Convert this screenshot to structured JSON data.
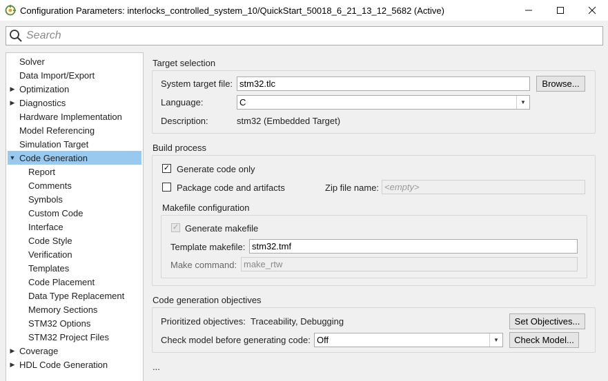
{
  "window": {
    "title": "Configuration Parameters: interlocks_controlled_system_10/QuickStart_50018_6_21_13_12_5682 (Active)",
    "controls": {
      "minimize": "—",
      "maximize": "☐",
      "close": "✕"
    }
  },
  "search": {
    "placeholder": "Search",
    "value": ""
  },
  "sidebar": {
    "items": [
      {
        "label": "Solver",
        "expandable": false,
        "selected": false
      },
      {
        "label": "Data Import/Export",
        "expandable": false,
        "selected": false
      },
      {
        "label": "Optimization",
        "expandable": true,
        "expanded": false,
        "selected": false
      },
      {
        "label": "Diagnostics",
        "expandable": true,
        "expanded": false,
        "selected": false
      },
      {
        "label": "Hardware Implementation",
        "expandable": false,
        "selected": false
      },
      {
        "label": "Model Referencing",
        "expandable": false,
        "selected": false
      },
      {
        "label": "Simulation Target",
        "expandable": false,
        "selected": false
      },
      {
        "label": "Code Generation",
        "expandable": true,
        "expanded": true,
        "selected": true
      },
      {
        "label": "Report",
        "child": true
      },
      {
        "label": "Comments",
        "child": true
      },
      {
        "label": "Symbols",
        "child": true
      },
      {
        "label": "Custom Code",
        "child": true
      },
      {
        "label": "Interface",
        "child": true
      },
      {
        "label": "Code Style",
        "child": true
      },
      {
        "label": "Verification",
        "child": true
      },
      {
        "label": "Templates",
        "child": true
      },
      {
        "label": "Code Placement",
        "child": true
      },
      {
        "label": "Data Type Replacement",
        "child": true
      },
      {
        "label": "Memory Sections",
        "child": true
      },
      {
        "label": "STM32 Options",
        "child": true
      },
      {
        "label": "STM32 Project Files",
        "child": true
      },
      {
        "label": "Coverage",
        "expandable": true,
        "expanded": false
      },
      {
        "label": "HDL Code Generation",
        "expandable": true,
        "expanded": false
      }
    ],
    "arrows": {
      "collapsed": "▶",
      "expanded": "▼"
    }
  },
  "target_selection": {
    "title": "Target selection",
    "system_target_file_label": "System target file:",
    "system_target_file_value": "stm32.tlc",
    "browse_label": "Browse...",
    "language_label": "Language:",
    "language_value": "C",
    "description_label": "Description:",
    "description_value": "stm32 (Embedded Target)"
  },
  "build_process": {
    "title": "Build process",
    "generate_code_only_label": "Generate code only",
    "generate_code_only_checked": true,
    "package_code_label": "Package code and artifacts",
    "package_code_checked": false,
    "zip_file_label": "Zip file name:",
    "zip_file_placeholder": "<empty>",
    "makefile": {
      "title": "Makefile configuration",
      "generate_makefile_label": "Generate makefile",
      "generate_makefile_checked": true,
      "template_makefile_label": "Template makefile:",
      "template_makefile_value": "stm32.tmf",
      "make_command_label": "Make command:",
      "make_command_value": "make_rtw"
    }
  },
  "objectives": {
    "title": "Code generation objectives",
    "prioritized_label": "Prioritized objectives:",
    "prioritized_value": "Traceability, Debugging",
    "set_objectives_label": "Set Objectives...",
    "check_model_label": "Check model before generating code:",
    "check_model_value": "Off",
    "check_model_button_label": "Check Model..."
  },
  "more_label": "...",
  "colors": {
    "selection": "#99c9ef",
    "background": "#f0f0f0",
    "panel_border": "#d6d6d6"
  }
}
